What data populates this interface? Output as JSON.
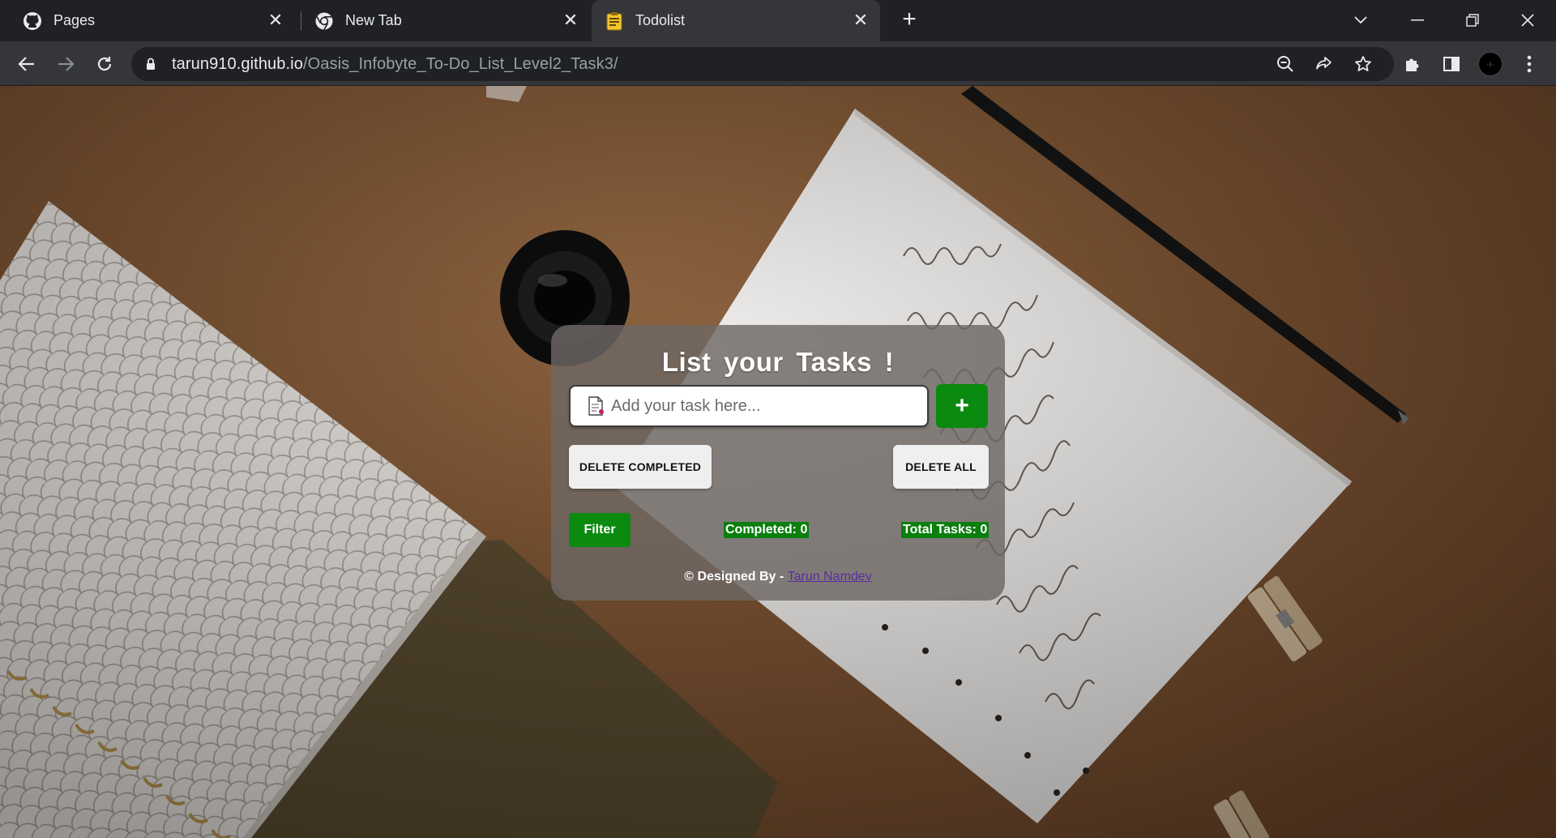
{
  "browser": {
    "tabs": [
      {
        "title": "Pages",
        "favicon": "github-icon",
        "active": false
      },
      {
        "title": "New Tab",
        "favicon": "chrome-icon",
        "active": false
      },
      {
        "title": "Todolist",
        "favicon": "todolist-icon",
        "active": true
      }
    ],
    "address": {
      "host": "tarun910.github.io",
      "path": "/Oasis_Infobyte_To-Do_List_Level2_Task3/"
    }
  },
  "app": {
    "title": "List your Tasks !",
    "input_placeholder": "Add your task here...",
    "add_label": "+",
    "delete_completed_label": "DELETE COMPLETED",
    "delete_all_label": "DELETE ALL",
    "filter_label": "Filter",
    "completed_text": "Completed: 0",
    "total_text": "Total Tasks: 0",
    "credit_prefix": "© Designed By - ",
    "credit_name": "Tarun Namdev"
  },
  "colors": {
    "accent_green": "#0a8a0f",
    "card_bg": "rgba(110,104,100,0.82)",
    "link": "#5a2ca0"
  }
}
